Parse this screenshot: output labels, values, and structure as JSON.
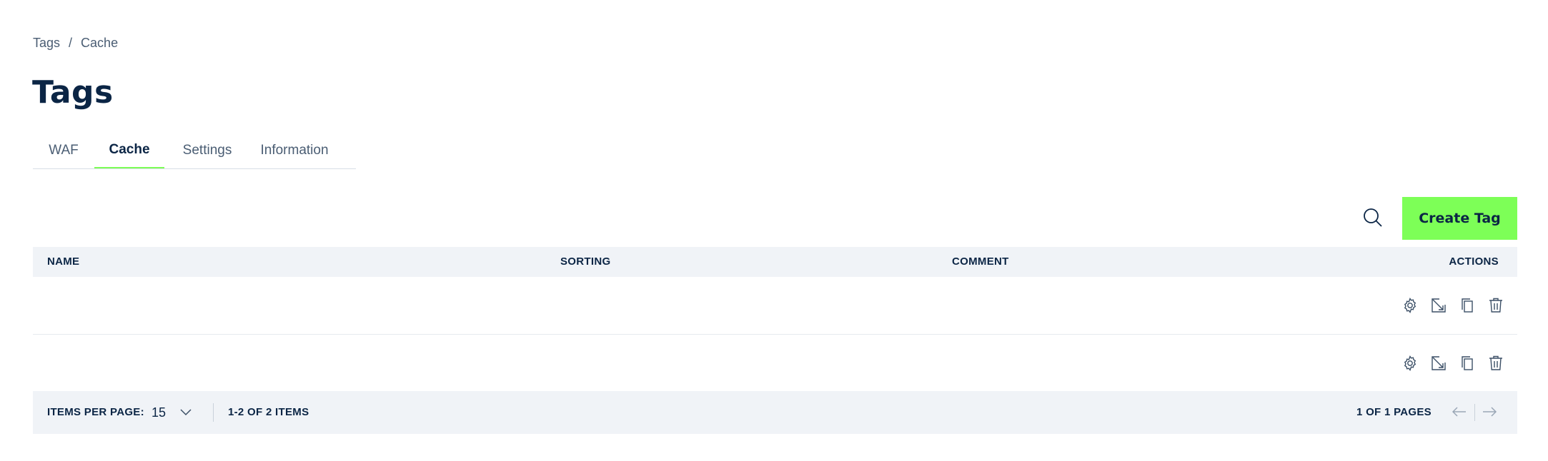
{
  "breadcrumb": {
    "items": [
      "Tags",
      "Cache"
    ],
    "separator": "/"
  },
  "page": {
    "title": "Tags"
  },
  "tabs": [
    {
      "label": "WAF",
      "active": false
    },
    {
      "label": "Cache",
      "active": true
    },
    {
      "label": "Settings",
      "active": false
    },
    {
      "label": "Information",
      "active": false
    }
  ],
  "toolbar": {
    "search_icon": "search-icon",
    "create_label": "Create Tag"
  },
  "table": {
    "headers": {
      "name": "NAME",
      "sorting": "SORTING",
      "comment": "COMMENT",
      "actions": "ACTIONS"
    },
    "rows": [
      {
        "name": "",
        "sorting": "",
        "comment": "",
        "actions": [
          "settings-icon",
          "edit-icon",
          "copy-icon",
          "delete-icon"
        ]
      },
      {
        "name": "",
        "sorting": "",
        "comment": "",
        "actions": [
          "settings-icon",
          "edit-icon",
          "copy-icon",
          "delete-icon"
        ]
      }
    ]
  },
  "pagination": {
    "items_per_page_label": "ITEMS PER PAGE:",
    "items_per_page_value": "15",
    "items_range": "1-2 OF 2 ITEMS",
    "pages": "1 OF 1 PAGES"
  },
  "colors": {
    "accent": "#7dff57",
    "text": "#0b2545",
    "muted": "#4a5d73",
    "surface": "#f0f3f7"
  }
}
